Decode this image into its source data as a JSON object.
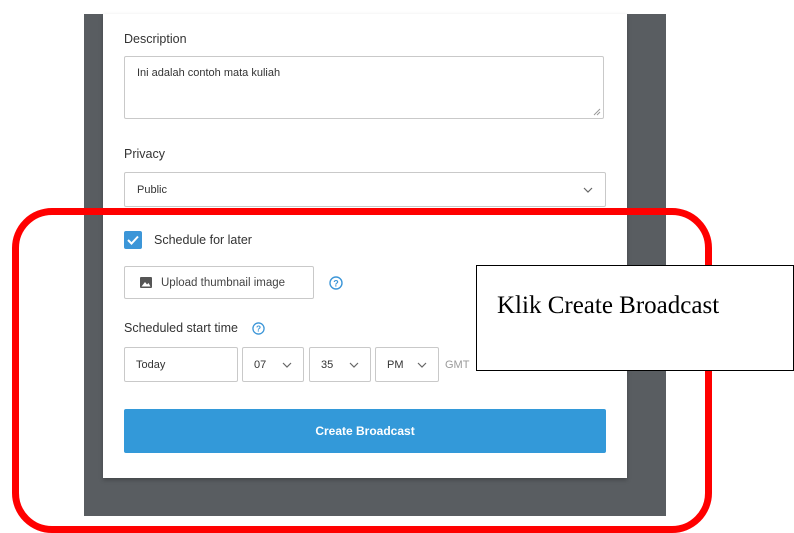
{
  "form": {
    "description_label": "Description",
    "description_value": "Ini adalah contoh mata kuliah",
    "privacy_label": "Privacy",
    "privacy_value": "Public",
    "schedule_checkbox_label": "Schedule for later",
    "schedule_checked": true,
    "upload_thumbnail_label": "Upload thumbnail image",
    "scheduled_start_label": "Scheduled start time",
    "start_day": "Today",
    "start_hour": "07",
    "start_minute": "35",
    "start_ampm": "PM",
    "timezone_label": "GMT",
    "create_button_label": "Create Broadcast"
  },
  "annotation": {
    "callout_text": "Klik Create Broadcast",
    "highlight_color": "#ff0000"
  },
  "colors": {
    "accent": "#3399d9",
    "checkbox": "#3c96d8",
    "backdrop": "#595d61"
  },
  "icons": {
    "dropdown": "chevron-down-icon",
    "help": "help-circle-icon",
    "upload": "image-icon",
    "check": "checkmark-icon"
  }
}
